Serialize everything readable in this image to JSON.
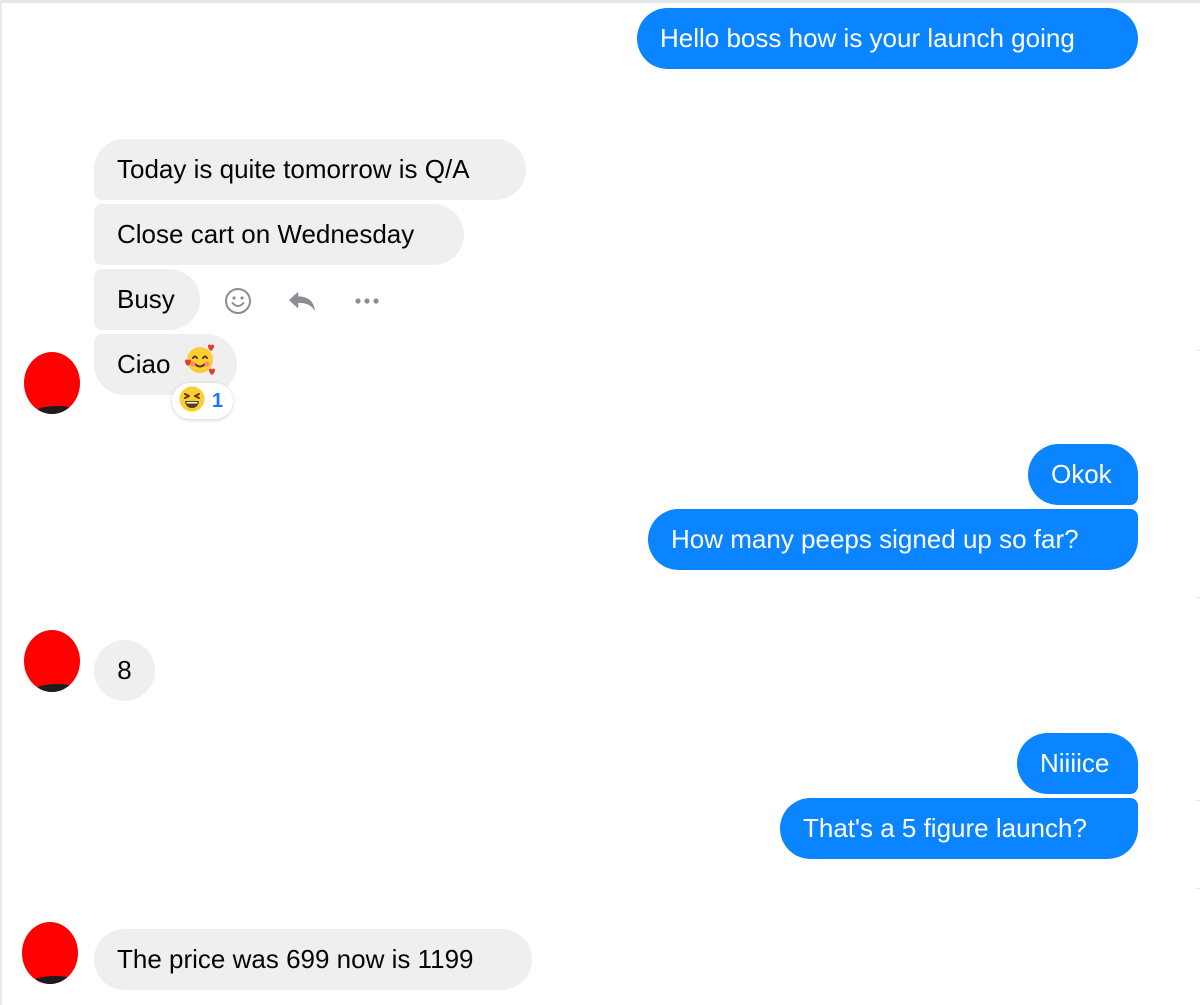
{
  "conversation": {
    "messages": [
      {
        "id": "m1",
        "sender": "me",
        "text": "Hello boss how is your launch going"
      },
      {
        "id": "m2",
        "sender": "them",
        "text": "Today is quite tomorrow is Q/A"
      },
      {
        "id": "m3",
        "sender": "them",
        "text": "Close cart on Wednesday"
      },
      {
        "id": "m4",
        "sender": "them",
        "text": "Busy"
      },
      {
        "id": "m5",
        "sender": "them",
        "text": "Ciao",
        "emoji": "smiling-face-with-hearts"
      },
      {
        "id": "m6",
        "sender": "me",
        "text": "Okok"
      },
      {
        "id": "m7",
        "sender": "me",
        "text": "How many peeps signed up so far?"
      },
      {
        "id": "m8",
        "sender": "them",
        "text": "8"
      },
      {
        "id": "m9",
        "sender": "me",
        "text": "Niiiice"
      },
      {
        "id": "m10",
        "sender": "me",
        "text": "That's a 5 figure launch?"
      },
      {
        "id": "m11",
        "sender": "them",
        "text": "The price was 699 now is 1199"
      }
    ],
    "reaction": {
      "emoji": "grinning-squinting-face",
      "count": "1"
    },
    "message_actions": [
      "smiley-icon",
      "reply-icon",
      "more-icon"
    ]
  },
  "colors": {
    "outgoing_bubble": "#0a84ff",
    "incoming_bubble": "#efefef",
    "avatar": "#ff0000",
    "reaction_count": "#1877f2"
  }
}
